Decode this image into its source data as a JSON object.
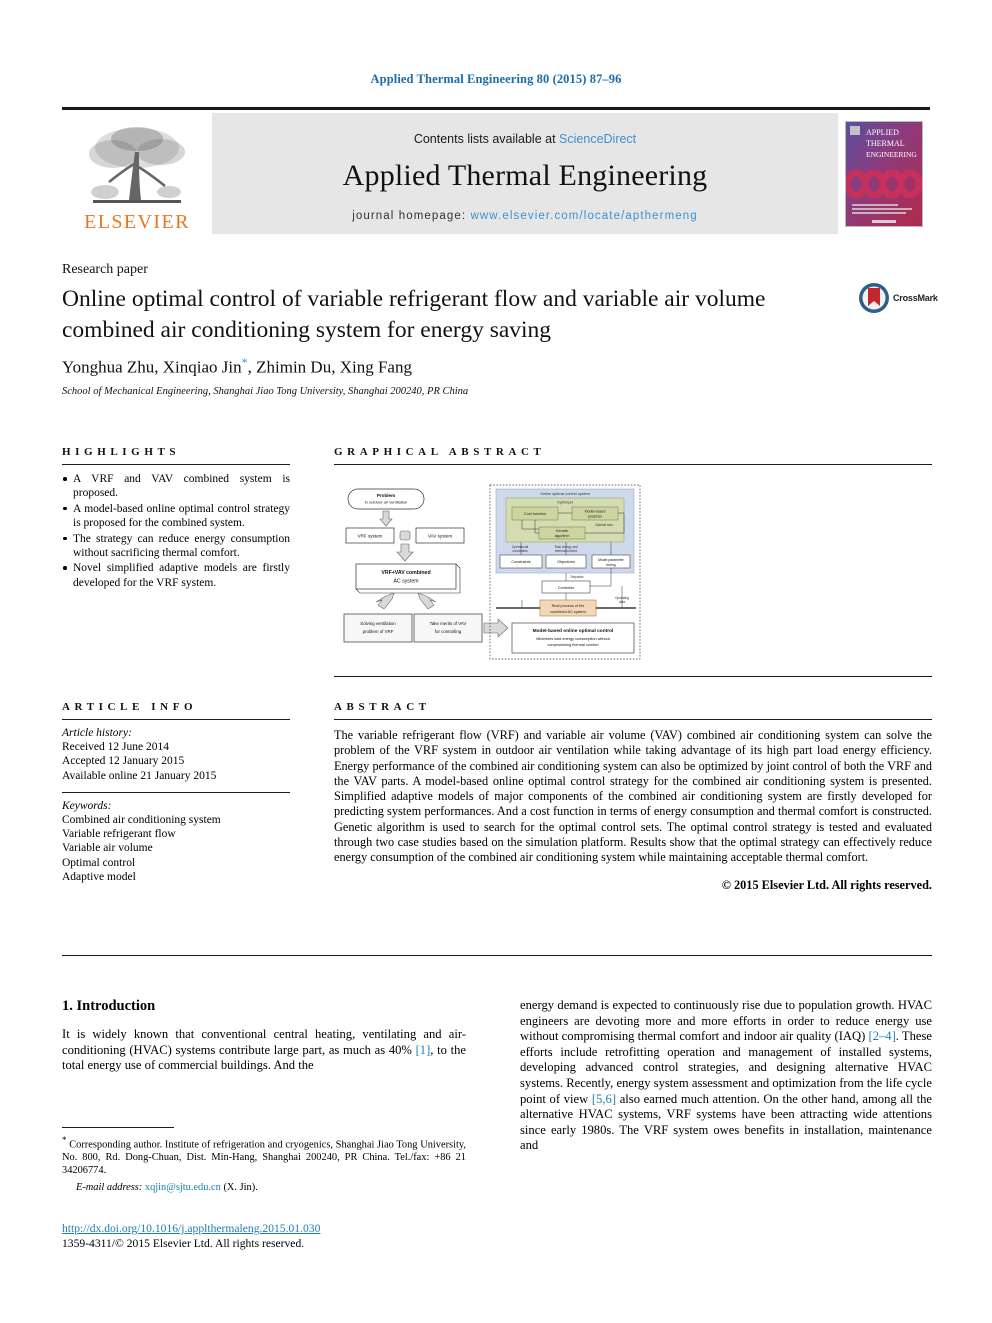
{
  "running_head": "Applied Thermal Engineering 80 (2015) 87–96",
  "masthead": {
    "publisher_name": "ELSEVIER",
    "contents_prefix": "Contents lists available at",
    "contents_link": "ScienceDirect",
    "journal_title": "Applied Thermal Engineering",
    "homepage_prefix": "journal homepage:",
    "homepage_url": "www.elsevier.com/locate/apthermeng",
    "cover_title_lines": [
      "APPLIED",
      "THERMAL",
      "ENGINEERING"
    ]
  },
  "article": {
    "type_label": "Research paper",
    "title": "Online optimal control of variable refrigerant flow and variable air volume combined air conditioning system for energy saving",
    "authors": "Yonghua Zhu, Xinqiao Jin",
    "authors_tail": ", Zhimin Du, Xing Fang",
    "corresponding_marker": "*",
    "affiliation": "School of Mechanical Engineering, Shanghai Jiao Tong University, Shanghai 200240, PR China",
    "crossmark_label": "CrossMark"
  },
  "highlights": {
    "heading": "HIGHLIGHTS",
    "items": [
      "A VRF and VAV combined system is proposed.",
      "A model-based online optimal control strategy is proposed for the combined system.",
      "The strategy can reduce energy consumption without sacrificing thermal comfort.",
      "Novel simplified adaptive models are firstly developed for the VRF system."
    ]
  },
  "graphical_abstract": {
    "heading": "GRAPHICAL ABSTRACT",
    "flow_nodes": {
      "problem_title": "Problem",
      "problem_sub": "in outdoor air ventilation",
      "vrf_system": "VRF system",
      "vav_system": "VAV system",
      "combined_line1": "VRF+VAV combined",
      "combined_line2": "AC system",
      "left_out_line1": "Solving ventilation",
      "left_out_line2": "problem of VRF",
      "right_out_line1": "Take merits of VAV",
      "right_out_line2": "for controlling"
    },
    "control_nodes": {
      "panel_title": "Online optimal control system",
      "optimizer": "Optimizer",
      "cost_function": "Cost function",
      "model_based_predictor": "Model-based predictor",
      "genetic_algorithm": "Genetic algorithm",
      "optimal_sets": "Optimal sets",
      "constraints": "Constraints",
      "objectives": "Objectives",
      "model_parameter_tuning": "Model parameter tuning",
      "operational_constraints": "Operational constraints",
      "energy_comfort": "Total energy and thermal comfort",
      "setpoints": "Setpoints",
      "controller": "Controller",
      "plant": "Real process of the combined AC system",
      "operating_data": "Operating data",
      "conclusion_title": "Model-based online optimal control",
      "conclusion_sub": "Minimizes total energy consumption without compromising thermal comfort"
    }
  },
  "article_info": {
    "heading": "ARTICLE INFO",
    "history_label": "Article history:",
    "history": [
      "Received 12 June 2014",
      "Accepted 12 January 2015",
      "Available online 21 January 2015"
    ],
    "keywords_label": "Keywords:",
    "keywords": [
      "Combined air conditioning system",
      "Variable refrigerant flow",
      "Variable air volume",
      "Optimal control",
      "Adaptive model"
    ]
  },
  "abstract": {
    "heading": "ABSTRACT",
    "text": "The variable refrigerant flow (VRF) and variable air volume (VAV) combined air conditioning system can solve the problem of the VRF system in outdoor air ventilation while taking advantage of its high part load energy efficiency. Energy performance of the combined air conditioning system can also be optimized by joint control of both the VRF and the VAV parts. A model-based online optimal control strategy for the combined air conditioning system is presented. Simplified adaptive models of major components of the combined air conditioning system are firstly developed for predicting system performances. And a cost function in terms of energy consumption and thermal comfort is constructed. Genetic algorithm is used to search for the optimal control sets. The optimal control strategy is tested and evaluated through two case studies based on the simulation platform. Results show that the optimal strategy can effectively reduce energy consumption of the combined air conditioning system while maintaining acceptable thermal comfort.",
    "copyright": "© 2015 Elsevier Ltd. All rights reserved."
  },
  "introduction": {
    "number_and_title": "1. Introduction",
    "left_paragraph_part1": "It is widely known that conventional central heating, ventilating and air-conditioning (HVAC) systems contribute large part, as much as 40% ",
    "left_ref1": "[1]",
    "left_paragraph_part2": ", to the total energy use of commercial buildings. And the",
    "right_part1": "energy demand is expected to continuously rise due to population growth. HVAC engineers are devoting more and more efforts in order to reduce energy use without compromising thermal comfort and indoor air quality (IAQ) ",
    "right_ref1": "[2–4]",
    "right_part2": ". These efforts include retrofitting operation and management of installed systems, developing advanced control strategies, and designing alternative HVAC systems. Recently, energy system assessment and optimization from the life cycle point of view ",
    "right_ref2": "[5,6]",
    "right_part3": " also earned much attention. On the other hand, among all the alternative HVAC systems, VRF systems have been attracting wide attentions since early 1980s. The VRF system owes benefits in installation, maintenance and"
  },
  "footnote": {
    "marker": "*",
    "text": "Corresponding author. Institute of refrigeration and cryogenics, Shanghai Jiao Tong University, No. 800, Rd. Dong-Chuan, Dist. Min-Hang, Shanghai 200240, PR China. Tel./fax: +86 21 34206774.",
    "email_label": "E-mail address:",
    "email": "xqjin@sjtu.edu.cn",
    "email_suffix": "(X. Jin)."
  },
  "imprint": {
    "doi_url": "http://dx.doi.org/10.1016/j.applthermaleng.2015.01.030",
    "issn_line": "1359-4311/© 2015 Elsevier Ltd. All rights reserved."
  },
  "colors": {
    "link_blue": "#1b7fb5",
    "sciencedirect_blue": "#3d8fd1",
    "elsevier_orange": "#e87722",
    "band_grey": "#e6e6e6"
  }
}
